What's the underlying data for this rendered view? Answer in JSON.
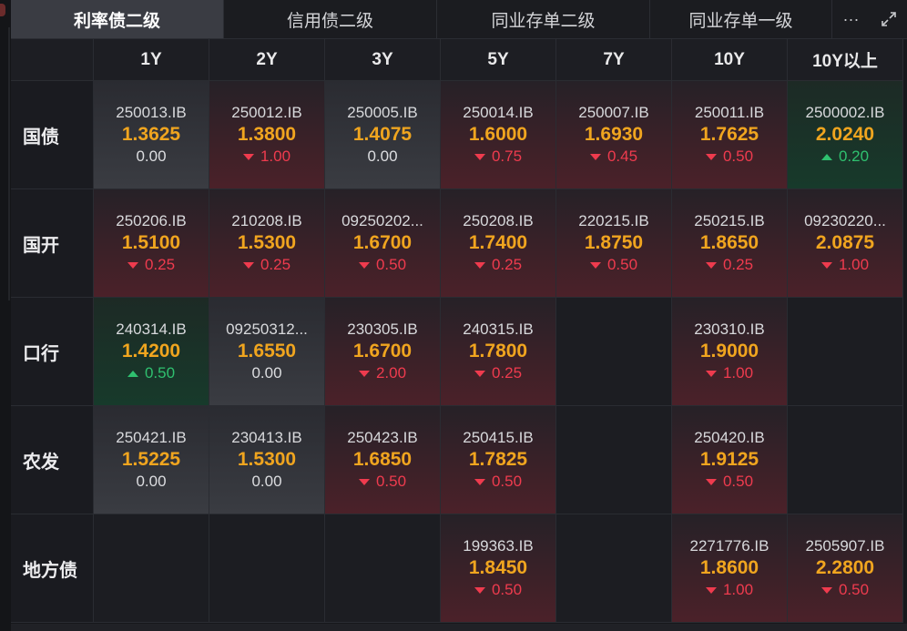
{
  "tabs": [
    {
      "label": "利率债二级",
      "active": true
    },
    {
      "label": "信用债二级",
      "active": false
    },
    {
      "label": "同业存单二级",
      "active": false
    },
    {
      "label": "同业存单一级",
      "active": false
    }
  ],
  "tools": {
    "more_icon": "more-icon",
    "more_glyph": "···",
    "expand_icon": "expand-icon"
  },
  "columns": [
    "1Y",
    "2Y",
    "3Y",
    "5Y",
    "7Y",
    "10Y",
    "10Y以上"
  ],
  "colors": {
    "rate": "#f0a51f",
    "down": "#ef3b4e",
    "up": "#2fc06f",
    "background": "#17181c"
  },
  "rows": [
    {
      "label": "国债",
      "cells": [
        {
          "code": "250013.IB",
          "rate": "1.3625",
          "change": "0.00",
          "dir": "flat"
        },
        {
          "code": "250012.IB",
          "rate": "1.3800",
          "change": "1.00",
          "dir": "down"
        },
        {
          "code": "250005.IB",
          "rate": "1.4075",
          "change": "0.00",
          "dir": "flat"
        },
        {
          "code": "250014.IB",
          "rate": "1.6000",
          "change": "0.75",
          "dir": "down"
        },
        {
          "code": "250007.IB",
          "rate": "1.6930",
          "change": "0.45",
          "dir": "down"
        },
        {
          "code": "250011.IB",
          "rate": "1.7625",
          "change": "0.50",
          "dir": "down"
        },
        {
          "code": "2500002.IB",
          "rate": "2.0240",
          "change": "0.20",
          "dir": "up"
        }
      ]
    },
    {
      "label": "国开",
      "cells": [
        {
          "code": "250206.IB",
          "rate": "1.5100",
          "change": "0.25",
          "dir": "down"
        },
        {
          "code": "210208.IB",
          "rate": "1.5300",
          "change": "0.25",
          "dir": "down"
        },
        {
          "code": "09250202...",
          "rate": "1.6700",
          "change": "0.50",
          "dir": "down"
        },
        {
          "code": "250208.IB",
          "rate": "1.7400",
          "change": "0.25",
          "dir": "down"
        },
        {
          "code": "220215.IB",
          "rate": "1.8750",
          "change": "0.50",
          "dir": "down"
        },
        {
          "code": "250215.IB",
          "rate": "1.8650",
          "change": "0.25",
          "dir": "down"
        },
        {
          "code": "09230220...",
          "rate": "2.0875",
          "change": "1.00",
          "dir": "down"
        }
      ]
    },
    {
      "label": "口行",
      "cells": [
        {
          "code": "240314.IB",
          "rate": "1.4200",
          "change": "0.50",
          "dir": "up"
        },
        {
          "code": "09250312...",
          "rate": "1.6550",
          "change": "0.00",
          "dir": "flat"
        },
        {
          "code": "230305.IB",
          "rate": "1.6700",
          "change": "2.00",
          "dir": "down"
        },
        {
          "code": "240315.IB",
          "rate": "1.7800",
          "change": "0.25",
          "dir": "down"
        },
        null,
        {
          "code": "230310.IB",
          "rate": "1.9000",
          "change": "1.00",
          "dir": "down"
        },
        null
      ]
    },
    {
      "label": "农发",
      "cells": [
        {
          "code": "250421.IB",
          "rate": "1.5225",
          "change": "0.00",
          "dir": "flat"
        },
        {
          "code": "230413.IB",
          "rate": "1.5300",
          "change": "0.00",
          "dir": "flat"
        },
        {
          "code": "250423.IB",
          "rate": "1.6850",
          "change": "0.50",
          "dir": "down"
        },
        {
          "code": "250415.IB",
          "rate": "1.7825",
          "change": "0.50",
          "dir": "down"
        },
        null,
        {
          "code": "250420.IB",
          "rate": "1.9125",
          "change": "0.50",
          "dir": "down"
        },
        null
      ]
    },
    {
      "label": "地方债",
      "cells": [
        null,
        null,
        null,
        {
          "code": "199363.IB",
          "rate": "1.8450",
          "change": "0.50",
          "dir": "down"
        },
        null,
        {
          "code": "2271776.IB",
          "rate": "1.8600",
          "change": "1.00",
          "dir": "down"
        },
        {
          "code": "2505907.IB",
          "rate": "2.2800",
          "change": "0.50",
          "dir": "down"
        }
      ]
    }
  ]
}
